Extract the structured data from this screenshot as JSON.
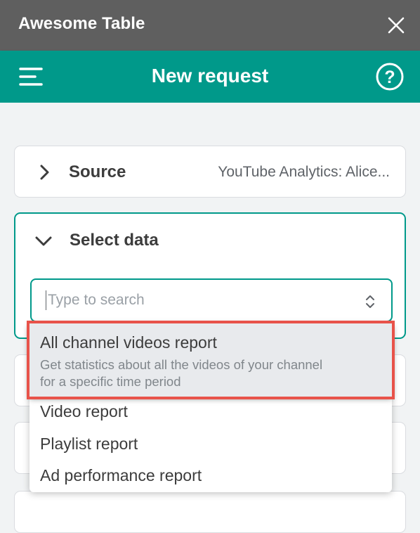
{
  "window": {
    "title": "Awesome Table",
    "close_icon": "close-icon"
  },
  "header": {
    "title": "New request",
    "menu_icon": "menu-icon",
    "help_icon": "help-circle-icon",
    "accent_color": "#00998a"
  },
  "source_card": {
    "title": "Source",
    "value": "YouTube Analytics: Alice...",
    "icon": "chevron-right-icon"
  },
  "select_data_card": {
    "title": "Select data",
    "icon": "chevron-down-icon",
    "search": {
      "value": "",
      "placeholder": "Type to search"
    }
  },
  "dropdown": {
    "options": [
      {
        "label": "All channel videos report",
        "description_line1": "Get statistics about all the videos of your channel",
        "description_line2": "for a specific time period",
        "highlighted": true
      },
      {
        "label": "Video report"
      },
      {
        "label": "Playlist report"
      },
      {
        "label": "Ad performance report"
      }
    ],
    "highlight_color": "#e8534a"
  }
}
